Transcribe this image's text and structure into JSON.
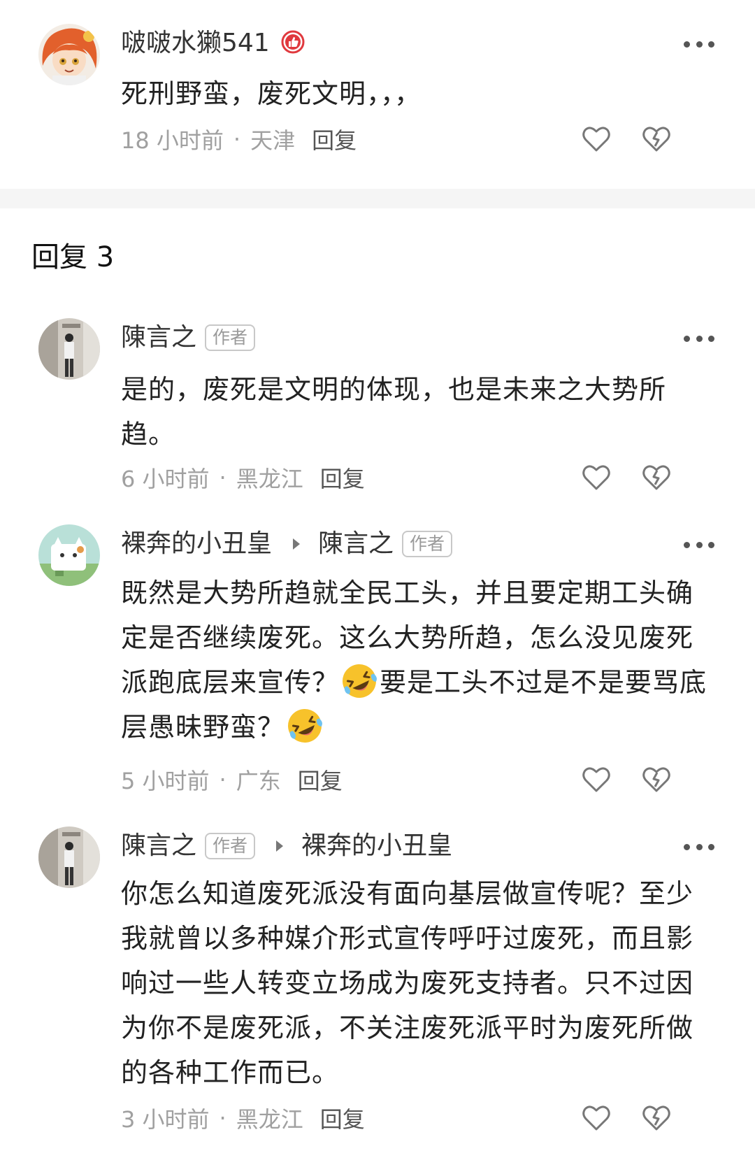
{
  "main_comment": {
    "username": "啵啵水獭541",
    "text": "死刑野蛮，废死文明，，，",
    "time": "18 小时前",
    "location": "天津",
    "reply_label": "回复"
  },
  "replies_section": {
    "title": "回复 3"
  },
  "replies": [
    {
      "username": "陳言之",
      "author_tag": "作者",
      "text": "是的，废死是文明的体现，也是未来之大势所趋。",
      "time": "6 小时前",
      "location": "黑龙江",
      "reply_label": "回复"
    },
    {
      "username": "裸奔的小丑皇",
      "reply_to": "陳言之",
      "reply_to_tag": "作者",
      "text_part1": "既然是大势所趋就全民工头，并且要定期工头确定是否继续废死。这么大势所趋，怎么没见废死派跑底层来宣传？",
      "text_part2": "要是工头不过是不是要骂底层愚昧野蛮？",
      "emoji": "rolling-laughing-emoji",
      "time": "5 小时前",
      "location": "广东",
      "reply_label": "回复"
    },
    {
      "username": "陳言之",
      "author_tag": "作者",
      "reply_to": "裸奔的小丑皇",
      "text": "你怎么知道废死派没有面向基层做宣传呢？至少我就曾以多种媒介形式宣传呼吁过废死，而且影响过一些人转变立场成为废死支持者。只不过因为你不是废死派，不关注废死派平时为废死所做的各种工作而已。",
      "time": "3 小时前",
      "location": "黑龙江",
      "reply_label": "回复"
    }
  ],
  "icons": {
    "more": "more-dots-icon",
    "like": "heart-outline-icon",
    "dislike": "broken-heart-icon",
    "badge": "thumbs-up-badge-icon"
  },
  "colors": {
    "text": "#222222",
    "meta": "#a0a0a0",
    "divider": "#f5f5f5",
    "badge": "#e0393e"
  }
}
